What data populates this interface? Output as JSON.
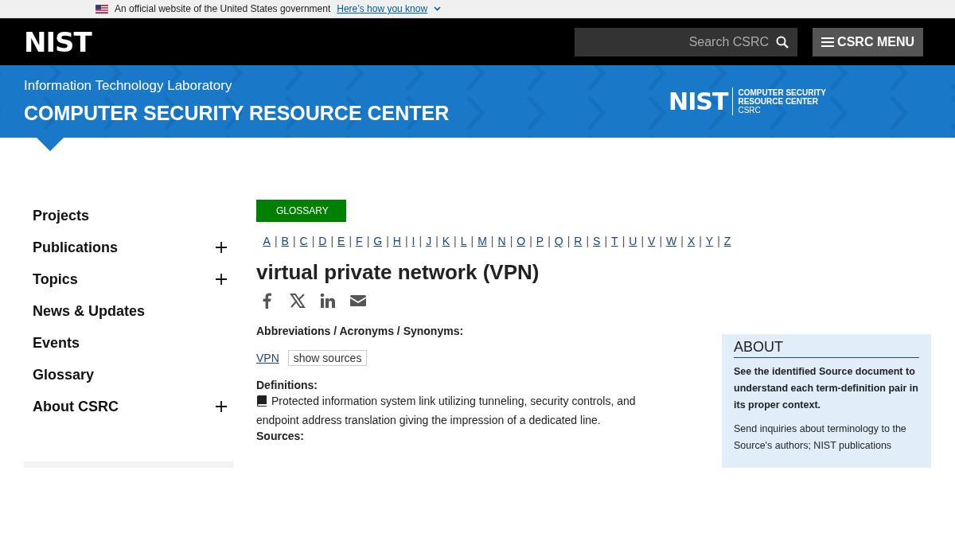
{
  "gov_banner": {
    "text": "An official website of the United States government",
    "link": "Here’s how you know"
  },
  "header": {
    "logo": "NIST",
    "search": {
      "placeholder": "Search CSRC"
    },
    "menu_button": "CSRC MENU"
  },
  "banner": {
    "subtitle": "Information Technology Laboratory",
    "title": "COMPUTER SECURITY RESOURCE CENTER",
    "logo": {
      "mark": "NIST",
      "line_1": "COMPUTER SECURITY",
      "line_2": "RESOURCE CENTER",
      "line_3": "CSRC"
    }
  },
  "sidebar": {
    "items": [
      {
        "label": "Projects",
        "expandable": false
      },
      {
        "label": "Publications",
        "expandable": true
      },
      {
        "label": "Topics",
        "expandable": true
      },
      {
        "label": "News & Updates",
        "expandable": false
      },
      {
        "label": "Events",
        "expandable": false
      },
      {
        "label": "Glossary",
        "expandable": false
      },
      {
        "label": "About CSRC",
        "expandable": true
      }
    ]
  },
  "content": {
    "badge": "GLOSSARY",
    "alphabet": [
      {
        "letter": "A",
        "separator": "|"
      },
      {
        "letter": "B",
        "separator": "|"
      },
      {
        "letter": "C",
        "separator": "|"
      },
      {
        "letter": "D",
        "separator": "|"
      },
      {
        "letter": "E",
        "separator": "|"
      },
      {
        "letter": "F",
        "separator": "|"
      },
      {
        "letter": "G",
        "separator": "|"
      },
      {
        "letter": "H",
        "separator": "|"
      },
      {
        "letter": "I",
        "separator": "|"
      },
      {
        "letter": "J",
        "separator": "|"
      },
      {
        "letter": "K",
        "separator": "|"
      },
      {
        "letter": "L",
        "separator": "|"
      },
      {
        "letter": "M",
        "separator": "|"
      },
      {
        "letter": "N",
        "separator": "|"
      },
      {
        "letter": "O",
        "separator": "|"
      },
      {
        "letter": "P",
        "separator": "|"
      },
      {
        "letter": "Q",
        "separator": "|"
      },
      {
        "letter": "R",
        "separator": "|"
      },
      {
        "letter": "S",
        "separator": "|"
      },
      {
        "letter": "T",
        "separator": "|"
      },
      {
        "letter": "U",
        "separator": "|"
      },
      {
        "letter": "V",
        "separator": "|"
      },
      {
        "letter": "W",
        "separator": "|"
      },
      {
        "letter": "X",
        "separator": "|"
      },
      {
        "letter": "Y",
        "separator": "|"
      },
      {
        "letter": "Z"
      }
    ],
    "term": "virtual private network (VPN)",
    "share": [
      {
        "kind": "facebook"
      },
      {
        "kind": "x"
      },
      {
        "kind": "linkedin"
      },
      {
        "kind": "email"
      }
    ],
    "abbreviations_label": "Abbreviations / Acronyms / Synonyms:",
    "abbreviation": "VPN",
    "show_sources": "show sources",
    "definitions_label": "Definitions:",
    "definition": "Protected information system link utilizing tunneling, security controls, and endpoint address translation giving the impression of a dedicated line.",
    "sources_label": "Sources:"
  },
  "about": {
    "title": "ABOUT",
    "intro": "See the identified Source document to understand each term-definition pair in its proper context.",
    "text": "Send inquiries about terminology to the Source's authors; NIST publications"
  }
}
